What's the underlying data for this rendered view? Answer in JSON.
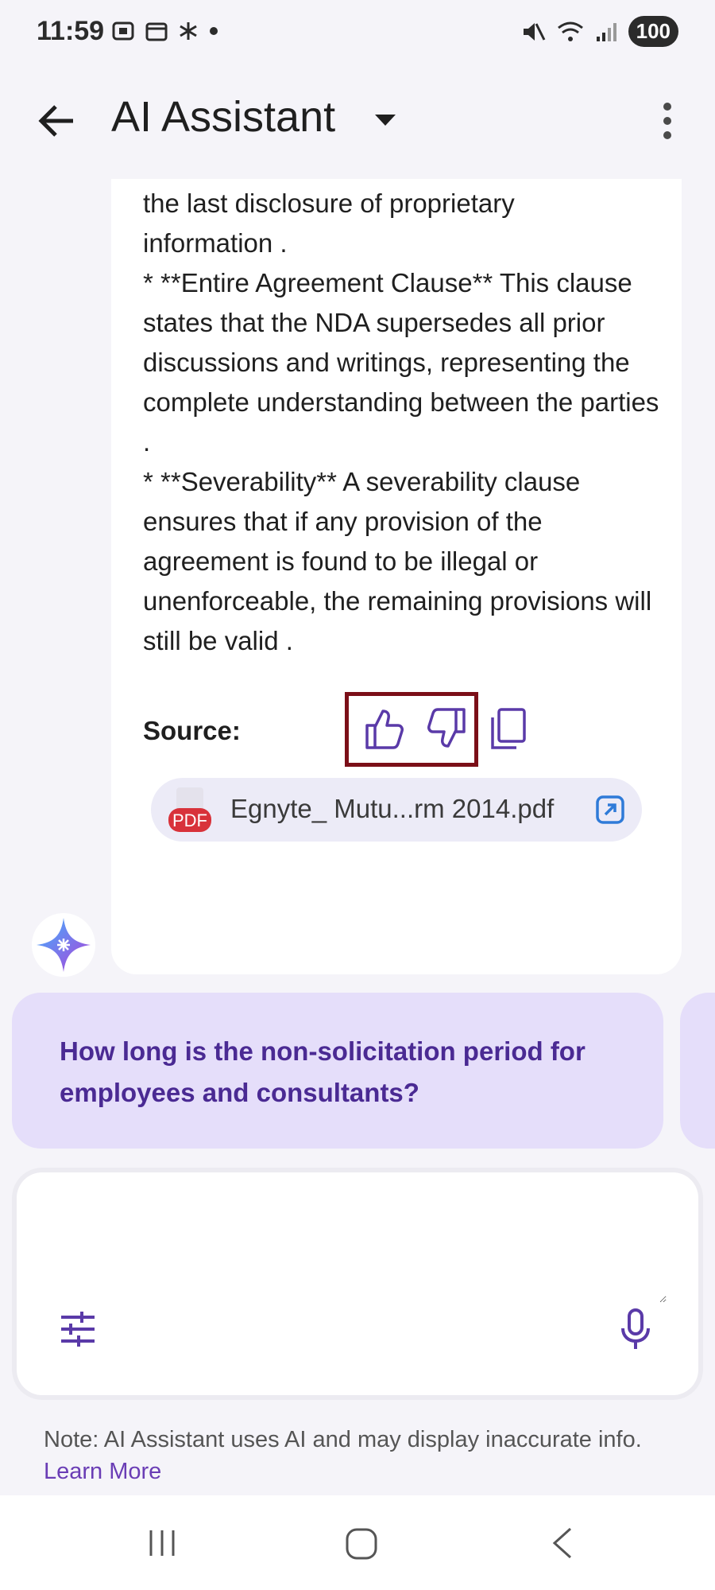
{
  "status_bar": {
    "time": "11:59",
    "battery": "100"
  },
  "app_bar": {
    "title": "AI Assistant"
  },
  "answer": {
    "text": "the last disclosure of proprietary\ninformation .\n*   **Entire Agreement Clause** This clause states that the NDA supersedes all prior discussions and writings, representing the complete understanding between the parties .\n*   **Severability** A severability clause ensures that if any provision of the agreement is found to be illegal or unenforceable, the remaining provisions will still be valid .",
    "source_label": "Source:",
    "source_file": "Egnyte_ Mutu...rm 2014.pdf",
    "pdf_badge": "PDF"
  },
  "suggestion": {
    "text": "How long is the non-solicitation period for employees and consultants?"
  },
  "input": {
    "placeholder": "",
    "value": ""
  },
  "note": {
    "text": "Note: AI Assistant uses AI and may display inaccurate info.",
    "link": "Learn More"
  },
  "colors": {
    "accent": "#6a3db5",
    "highlight_box": "#7b0f18",
    "suggestion_bg": "#e5defa"
  }
}
